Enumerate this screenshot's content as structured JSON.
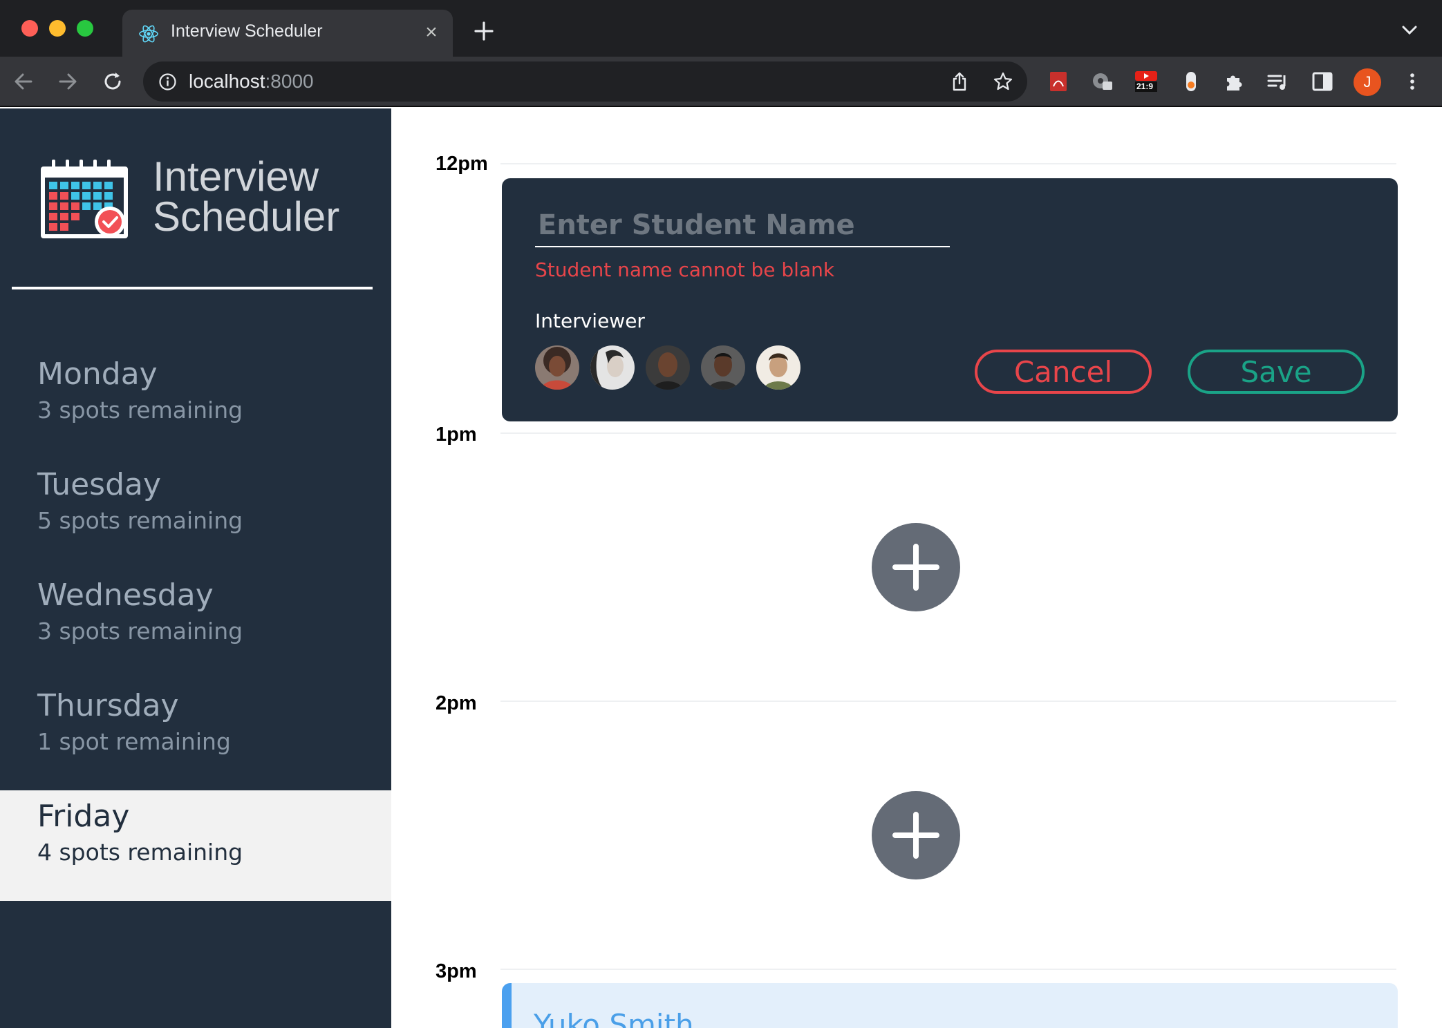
{
  "browser": {
    "tab_title": "Interview Scheduler",
    "url_host": "localhost",
    "url_port": ":8000",
    "extension_badge": "21:9",
    "profile_initial": "J"
  },
  "sidebar": {
    "brand_line1": "Interview",
    "brand_line2": "Scheduler",
    "days": [
      {
        "name": "Monday",
        "spots": "3 spots remaining",
        "selected": false
      },
      {
        "name": "Tuesday",
        "spots": "5 spots remaining",
        "selected": false
      },
      {
        "name": "Wednesday",
        "spots": "3 spots remaining",
        "selected": false
      },
      {
        "name": "Thursday",
        "spots": "1 spot remaining",
        "selected": false
      },
      {
        "name": "Friday",
        "spots": "4 spots remaining",
        "selected": true
      }
    ]
  },
  "schedule": {
    "times": [
      "12pm",
      "1pm",
      "2pm",
      "3pm"
    ],
    "form": {
      "name_value": "",
      "name_placeholder": "Enter Student Name",
      "error": "Student name cannot be blank",
      "interviewer_label": "Interviewer",
      "cancel_label": "Cancel",
      "save_label": "Save"
    },
    "booked_student": "Yuko Smith"
  },
  "colors": {
    "sidebar_bg": "#222f3e",
    "danger": "#e8454a",
    "success": "#1aa387",
    "booked_accent": "#4ba0ef"
  }
}
